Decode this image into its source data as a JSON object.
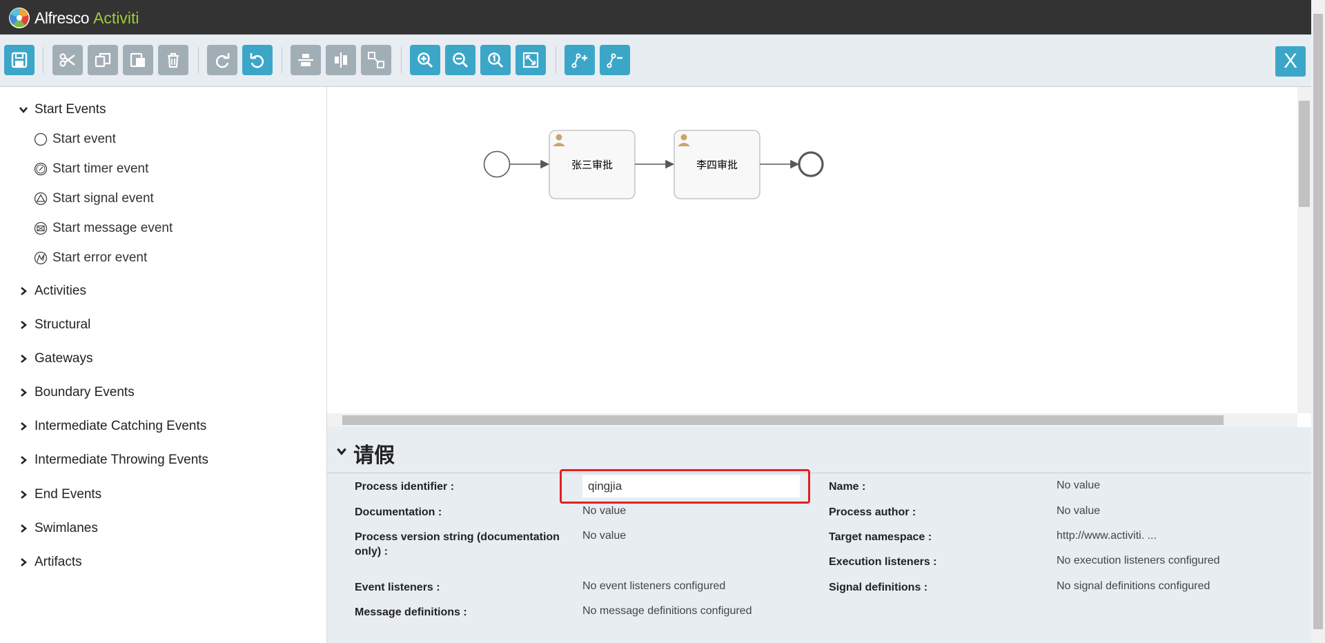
{
  "header": {
    "brand": "Alfresco",
    "product": "Activiti"
  },
  "toolbar": {
    "buttons": [
      {
        "name": "save",
        "icon": "save-icon"
      },
      {
        "name": "cut",
        "icon": "scissors-icon"
      },
      {
        "name": "copy",
        "icon": "copy-icon"
      },
      {
        "name": "paste",
        "icon": "paste-icon"
      },
      {
        "name": "delete",
        "icon": "trash-icon"
      },
      {
        "name": "redo",
        "icon": "redo-icon"
      },
      {
        "name": "undo",
        "icon": "undo-icon"
      },
      {
        "name": "align-horizontal",
        "icon": "align-horizontal-icon"
      },
      {
        "name": "align-vertical",
        "icon": "align-vertical-icon"
      },
      {
        "name": "same-size",
        "icon": "same-size-icon"
      },
      {
        "name": "zoom-in",
        "icon": "zoom-in-icon"
      },
      {
        "name": "zoom-out",
        "icon": "zoom-out-icon"
      },
      {
        "name": "zoom-actual",
        "icon": "zoom-actual-icon"
      },
      {
        "name": "zoom-fit",
        "icon": "zoom-fit-icon"
      },
      {
        "name": "add-bendpoint",
        "icon": "add-bendpoint-icon"
      },
      {
        "name": "remove-bendpoint",
        "icon": "remove-bendpoint-icon"
      }
    ],
    "close_label": "X"
  },
  "palette": {
    "start_events": {
      "label": "Start Events",
      "items": [
        "Start event",
        "Start timer event",
        "Start signal event",
        "Start message event",
        "Start error event"
      ]
    },
    "groups": [
      "Activities",
      "Structural",
      "Gateways",
      "Boundary Events",
      "Intermediate Catching Events",
      "Intermediate Throwing Events",
      "End Events",
      "Swimlanes",
      "Artifacts"
    ]
  },
  "diagram": {
    "tasks": [
      "张三审批",
      "李四审批"
    ]
  },
  "properties": {
    "title": "请假",
    "fields": {
      "process_identifier": {
        "label": "Process identifier :",
        "value": "qingjia"
      },
      "documentation": {
        "label": "Documentation :",
        "value": "No value"
      },
      "version": {
        "label": "Process version string (documentation only) :",
        "value": "No value"
      },
      "event_listeners": {
        "label": "Event listeners :",
        "value": "No event listeners configured"
      },
      "message_definitions": {
        "label": "Message definitions :",
        "value": "No message definitions configured"
      },
      "name": {
        "label": "Name :",
        "value": "No value"
      },
      "process_author": {
        "label": "Process author :",
        "value": "No value"
      },
      "target_namespace": {
        "label": "Target namespace :",
        "value": "http://www.activiti. ..."
      },
      "execution_listeners": {
        "label": "Execution listeners :",
        "value": "No execution listeners configured"
      },
      "signal_definitions": {
        "label": "Signal definitions :",
        "value": "No signal definitions configured"
      }
    }
  },
  "colors": {
    "accent": "#3ba6c8",
    "disabled": "#a2aeb6",
    "highlight": "#e02020",
    "brand_green": "#9ccc3a"
  }
}
